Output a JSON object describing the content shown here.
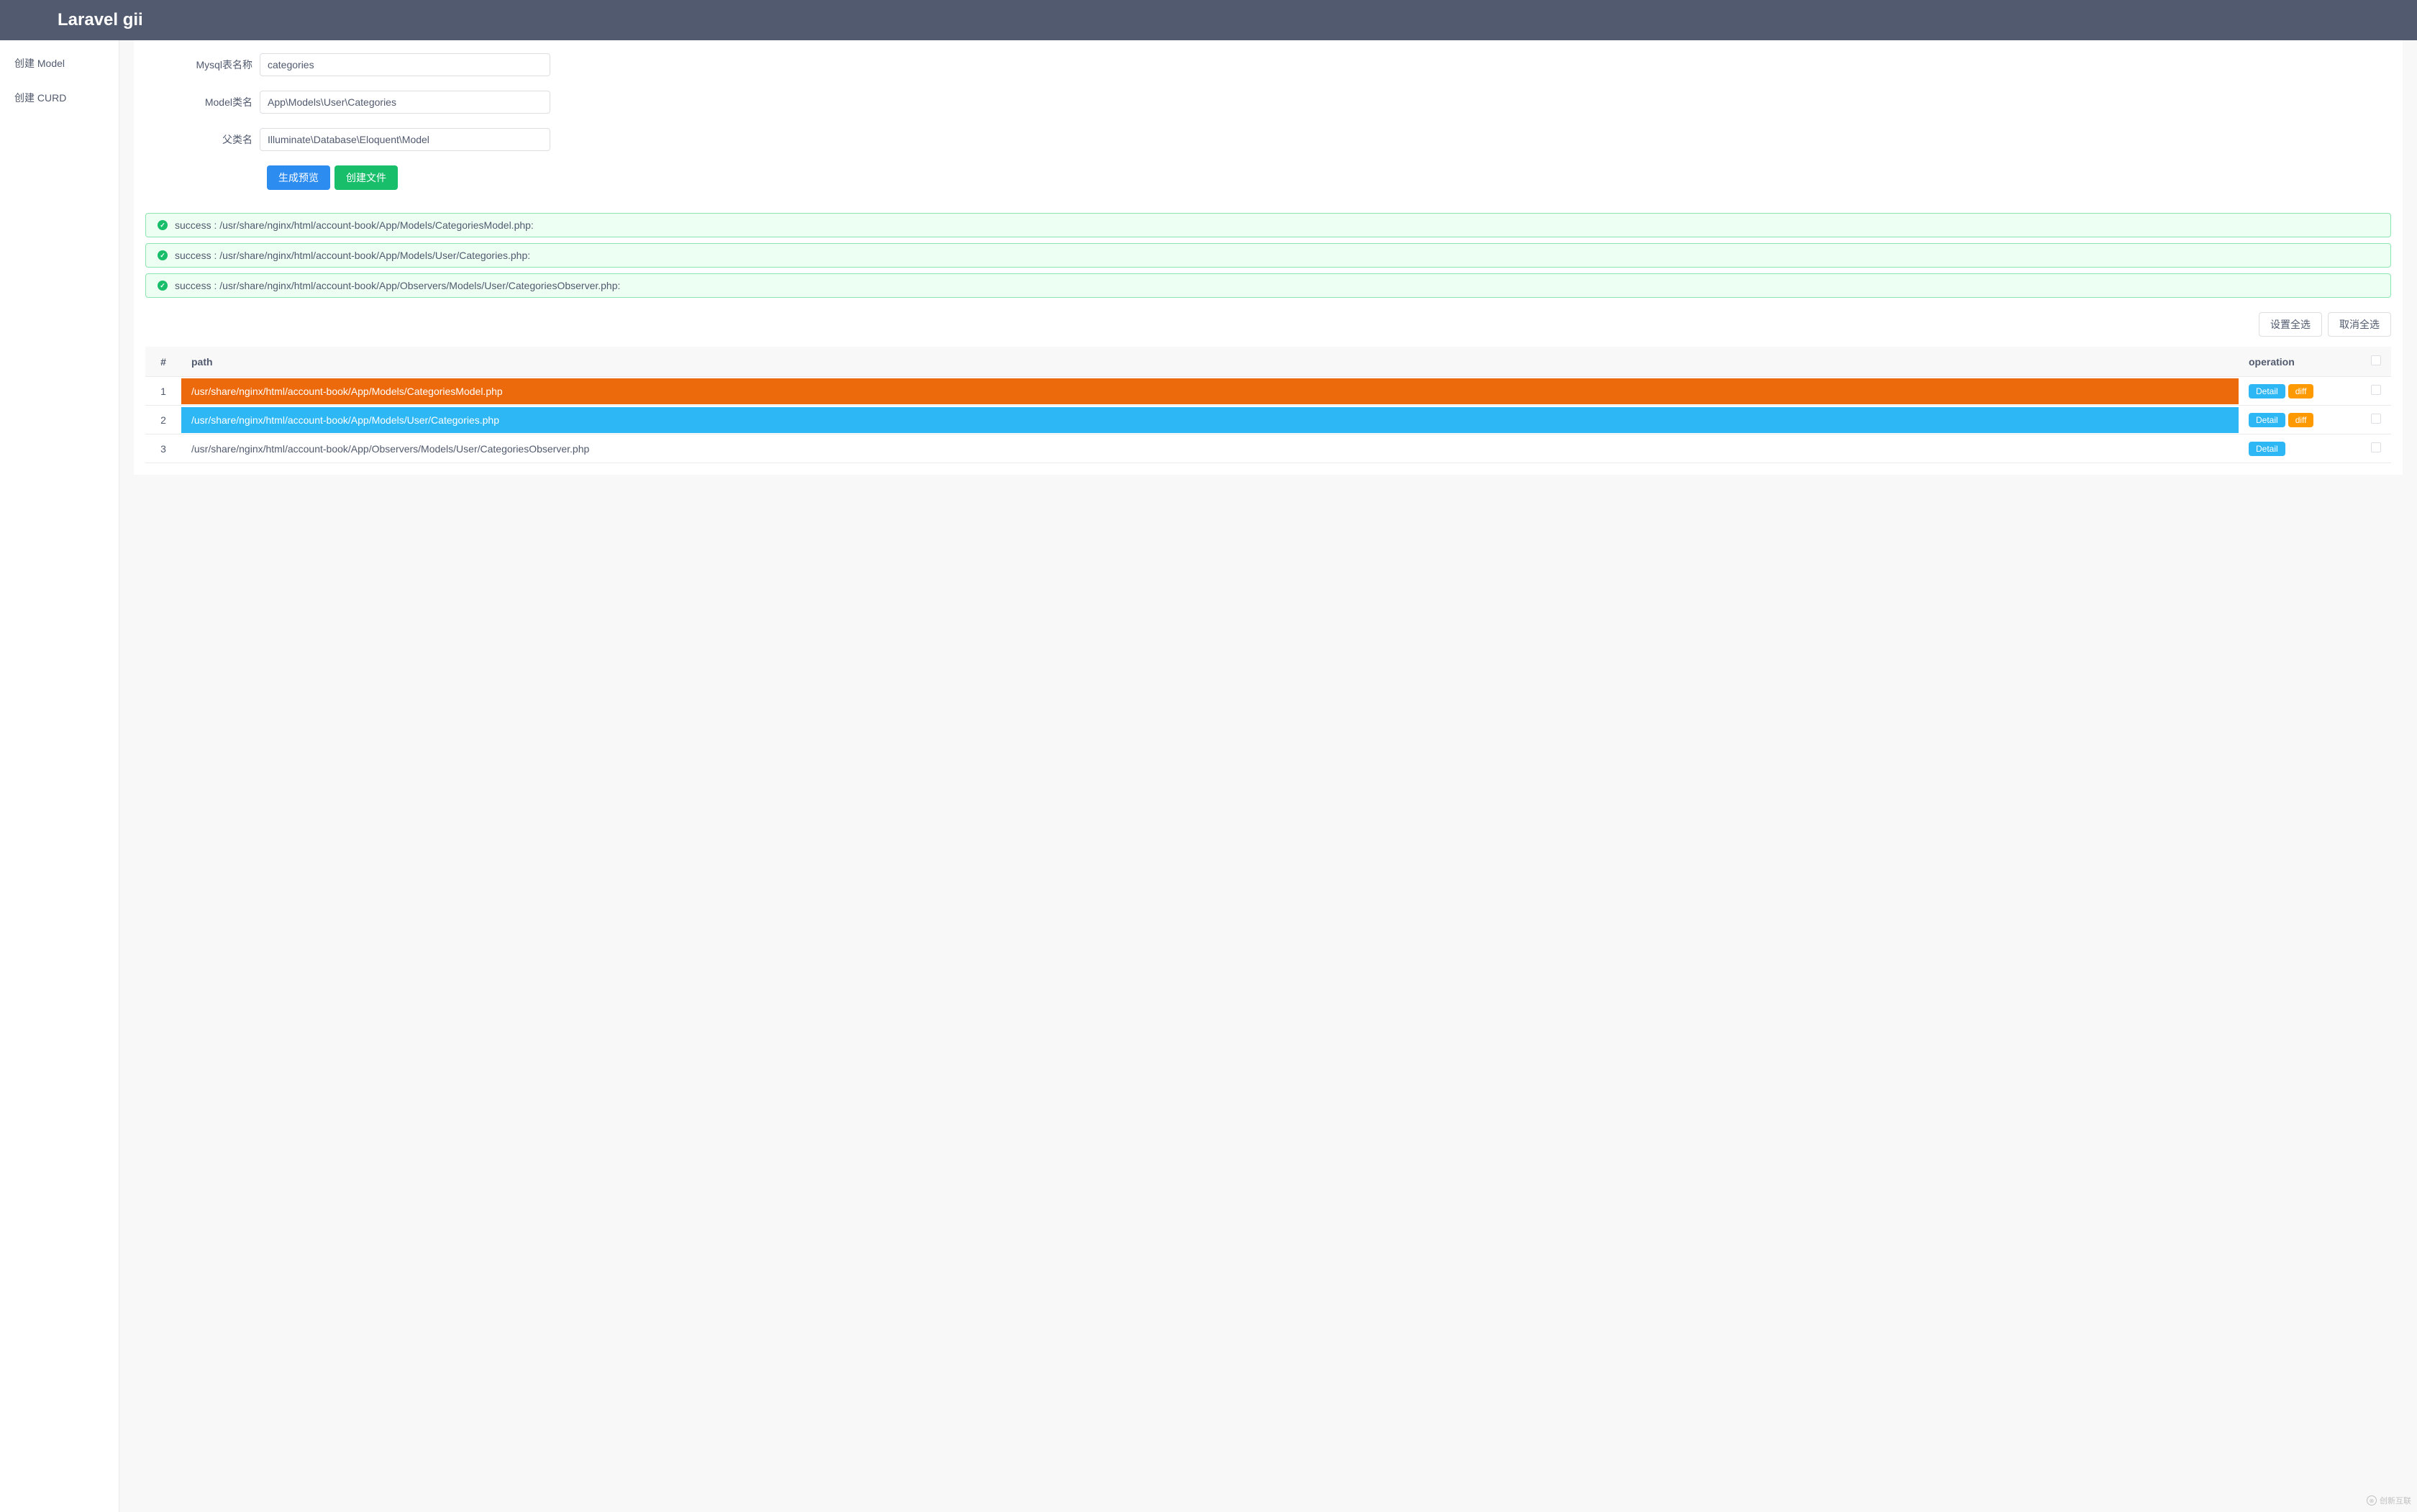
{
  "header": {
    "title": "Laravel gii"
  },
  "sidebar": {
    "items": [
      {
        "label": "创建 Model"
      },
      {
        "label": "创建 CURD"
      }
    ]
  },
  "form": {
    "fields": [
      {
        "label": "Mysql表名称",
        "value": "categories"
      },
      {
        "label": "Model类名",
        "value": "App\\Models\\User\\Categories"
      },
      {
        "label": "父类名",
        "value": "Illuminate\\Database\\Eloquent\\Model"
      }
    ],
    "buttons": {
      "preview": "生成预览",
      "create": "创建文件"
    }
  },
  "alerts": [
    {
      "text": "success : /usr/share/nginx/html/account-book/App/Models/CategoriesModel.php:"
    },
    {
      "text": "success : /usr/share/nginx/html/account-book/App/Models/User/Categories.php:"
    },
    {
      "text": "success : /usr/share/nginx/html/account-book/App/Observers/Models/User/CategoriesObserver.php:"
    }
  ],
  "selectButtons": {
    "selectAll": "设置全选",
    "deselectAll": "取消全选"
  },
  "table": {
    "headers": {
      "idx": "#",
      "path": "path",
      "operation": "operation"
    },
    "operationLabels": {
      "detail": "Detail",
      "diff": "diff"
    },
    "rows": [
      {
        "idx": "1",
        "path": "/usr/share/nginx/html/account-book/App/Models/CategoriesModel.php",
        "pathClass": "path-orange",
        "hasDiff": true
      },
      {
        "idx": "2",
        "path": "/usr/share/nginx/html/account-book/App/Models/User/Categories.php",
        "pathClass": "path-blue",
        "hasDiff": true
      },
      {
        "idx": "3",
        "path": "/usr/share/nginx/html/account-book/App/Observers/Models/User/CategoriesObserver.php",
        "pathClass": "path-plain",
        "hasDiff": false
      }
    ]
  },
  "watermark": {
    "text": "创新互联"
  }
}
